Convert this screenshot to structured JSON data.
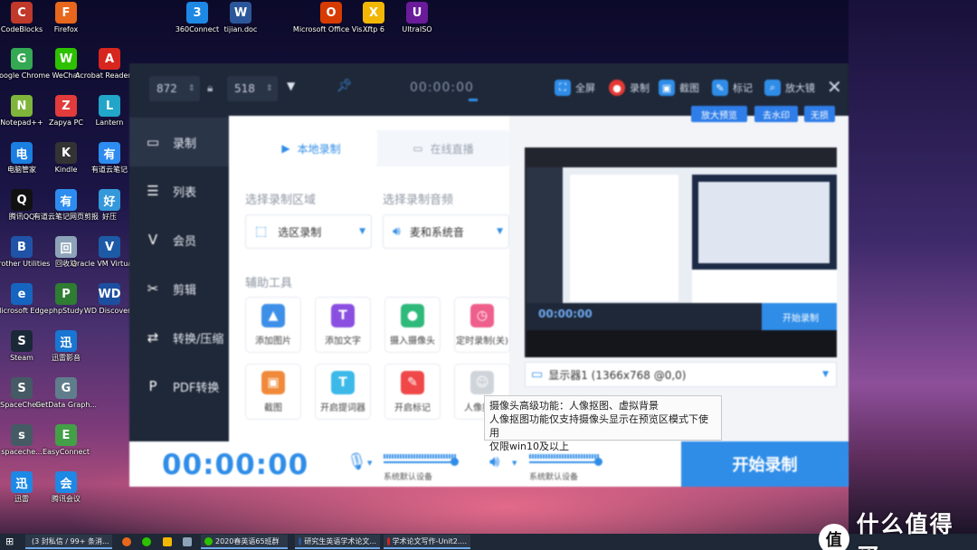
{
  "desktop": {
    "icons": [
      {
        "id": "codeblocks",
        "label": "CodeBlocks",
        "color": "#c0392b",
        "glyph": "C"
      },
      {
        "id": "firefox",
        "label": "Firefox",
        "color": "#e8671c",
        "glyph": "F"
      },
      {
        "id": "chrome",
        "label": "Google Chrome",
        "color": "#34a853",
        "glyph": "G"
      },
      {
        "id": "wechat",
        "label": "WeChat",
        "color": "#2dc100",
        "glyph": "W"
      },
      {
        "id": "acrobat",
        "label": "Acrobat Reader DC",
        "color": "#d7261e",
        "glyph": "A"
      },
      {
        "id": "notepad",
        "label": "Notepad++",
        "color": "#7fb53a",
        "glyph": "N"
      },
      {
        "id": "zapya",
        "label": "Zapya PC",
        "color": "#e23b3b",
        "glyph": "Z"
      },
      {
        "id": "lantern",
        "label": "Lantern",
        "color": "#21a5c9",
        "glyph": "L"
      },
      {
        "id": "pcmgr",
        "label": "电脑管家",
        "color": "#1a7fe0",
        "glyph": "电"
      },
      {
        "id": "kindle",
        "label": "Kindle",
        "color": "#333333",
        "glyph": "K"
      },
      {
        "id": "youdao",
        "label": "有道云笔记",
        "color": "#2d8cf0",
        "glyph": "有"
      },
      {
        "id": "qq",
        "label": "腾讯QQ",
        "color": "#111111",
        "glyph": "Q"
      },
      {
        "id": "youdaoweb",
        "label": "有道云笔记网页剪报",
        "color": "#2d8cf0",
        "glyph": "有"
      },
      {
        "id": "haoya",
        "label": "好压",
        "color": "#3498db",
        "glyph": "好"
      },
      {
        "id": "brother",
        "label": "Brother Utilities",
        "color": "#1f53a8",
        "glyph": "B"
      },
      {
        "id": "recycle",
        "label": "回收站",
        "color": "#8da4b8",
        "glyph": "回"
      },
      {
        "id": "virtualbox",
        "label": "Oracle VM VirtualBox",
        "color": "#1c5aa6",
        "glyph": "V"
      },
      {
        "id": "edge",
        "label": "Microsoft Edge",
        "color": "#1565c0",
        "glyph": "e"
      },
      {
        "id": "phpstudy",
        "label": "phpStudy",
        "color": "#2e7d32",
        "glyph": "P"
      },
      {
        "id": "wd",
        "label": "WD Discovery",
        "color": "#1d4fa1",
        "glyph": "WD"
      },
      {
        "id": "steam",
        "label": "Steam",
        "color": "#1b2838",
        "glyph": "S"
      },
      {
        "id": "xunlei",
        "label": "迅雷影音",
        "color": "#1976d2",
        "glyph": "迅"
      },
      {
        "id": "spacechem",
        "label": "SpaceChem",
        "color": "#455a64",
        "glyph": "S"
      },
      {
        "id": "getdata",
        "label": "GetData Graph...",
        "color": "#607d8b",
        "glyph": "G"
      },
      {
        "id": "spacechem2",
        "label": "spaceche...",
        "color": "#455a64",
        "glyph": "s"
      },
      {
        "id": "easyconnect",
        "label": "EasyConnect",
        "color": "#43a047",
        "glyph": "E"
      },
      {
        "id": "xunlei2",
        "label": "迅雷",
        "color": "#1e88e5",
        "glyph": "迅"
      },
      {
        "id": "meeting",
        "label": "腾讯会议",
        "color": "#1e88e5",
        "glyph": "会"
      },
      {
        "id": "360",
        "label": "360Connect",
        "color": "#1e88e5",
        "glyph": "3"
      },
      {
        "id": "tijian",
        "label": "tijian.doc",
        "color": "#2b579a",
        "glyph": "W"
      },
      {
        "id": "office",
        "label": "Microsoft Office Vis...",
        "color": "#d83b01",
        "glyph": "O"
      },
      {
        "id": "xftp",
        "label": "Xftp 6",
        "color": "#f2b705",
        "glyph": "X"
      },
      {
        "id": "ultraiso",
        "label": "UltraISO",
        "color": "#6a1b9a",
        "glyph": "U"
      }
    ]
  },
  "app": {
    "toolbar": {
      "width_value": "872",
      "height_value": "518",
      "timer": "00:00:00",
      "fullscreen_label": "全屏",
      "record_label": "录制",
      "screenshot_label": "截图",
      "mark_label": "标记",
      "magnifier_label": "放大镜"
    },
    "sidebar": {
      "items": [
        {
          "label": "录制",
          "icon": "video-icon"
        },
        {
          "label": "列表",
          "icon": "list-icon"
        },
        {
          "label": "会员",
          "icon": "vip-icon"
        },
        {
          "label": "剪辑",
          "icon": "scissors-icon"
        },
        {
          "label": "转换/压缩",
          "icon": "convert-icon"
        },
        {
          "label": "PDF转换",
          "icon": "pdf-icon"
        }
      ]
    },
    "main": {
      "tab_local": "本地录制",
      "tab_live": "在线直播",
      "area_label": "选择录制区域",
      "audio_label": "选择录制音频",
      "area_value": "选区录制",
      "audio_value": "麦和系统音",
      "tools_label": "辅助工具",
      "tools": [
        {
          "label": "添加图片",
          "color": "#3d8fe8",
          "glyph": "▲"
        },
        {
          "label": "添加文字",
          "color": "#8a4fe0",
          "glyph": "T"
        },
        {
          "label": "摄入摄像头",
          "color": "#2fb97a",
          "glyph": "●"
        },
        {
          "label": "定时录制(关)",
          "color": "#ef5f8c",
          "glyph": "◷"
        },
        {
          "label": "截图",
          "color": "#f08a3a",
          "glyph": "▣"
        },
        {
          "label": "开启提词器",
          "color": "#3cb9e8",
          "glyph": "T"
        },
        {
          "label": "开启标记",
          "color": "#f04848",
          "glyph": "✎"
        },
        {
          "label": "人像抠图",
          "color": "#cfd4da",
          "glyph": "☺"
        }
      ]
    },
    "preview": {
      "btn_zoom": "放大预览",
      "btn_watermark": "去水印",
      "btn_borderless": "无损",
      "display_value": "显示器1 (1366x768 @0,0)",
      "inner_timer": "00:00:00",
      "inner_start": "开始录制"
    },
    "tooltip": {
      "line1": "摄像头高级功能：人像抠图、虚拟背景",
      "line2": "人像抠图功能仅支持摄像头显示在预览区模式下使用",
      "line3": "仅限win10及以上"
    },
    "bottom": {
      "timer": "00:00:00",
      "mic_device": "系统默认设备",
      "speaker_device": "系统默认设备",
      "start_label": "开始录制"
    }
  },
  "taskbar": {
    "tasks": [
      {
        "label": "(3 封私信 / 99+ 条消...",
        "color": "#e8671c"
      },
      {
        "label": "2020春英语65班群",
        "color": "#2dc100"
      },
      {
        "label": "研究生英语学术论文...",
        "color": "#2b579a"
      },
      {
        "label": "学术论文写作-Unit2....",
        "color": "#d7261e"
      }
    ]
  },
  "watermark": {
    "text": "什么值得买",
    "glyph": "值"
  }
}
